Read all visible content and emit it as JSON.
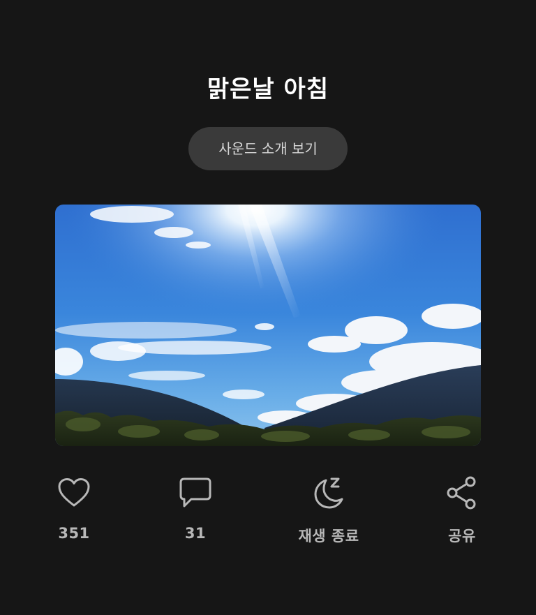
{
  "header": {
    "title": "맑은날 아침"
  },
  "intro_button": {
    "label": "사운드 소개 보기"
  },
  "hero_image": {
    "icon": "sunny-sky-mountains-image"
  },
  "actions": [
    {
      "name": "like",
      "icon": "heart-icon",
      "label": "351"
    },
    {
      "name": "comment",
      "icon": "comment-icon",
      "label": "31"
    },
    {
      "name": "sleep-timer",
      "icon": "moon-sleep-icon",
      "label": "재생 종료"
    },
    {
      "name": "share",
      "icon": "share-icon",
      "label": "공유"
    }
  ],
  "colors": {
    "background": "#161616",
    "button_bg": "#3a3a3a",
    "icon": "#b8b8b8"
  }
}
